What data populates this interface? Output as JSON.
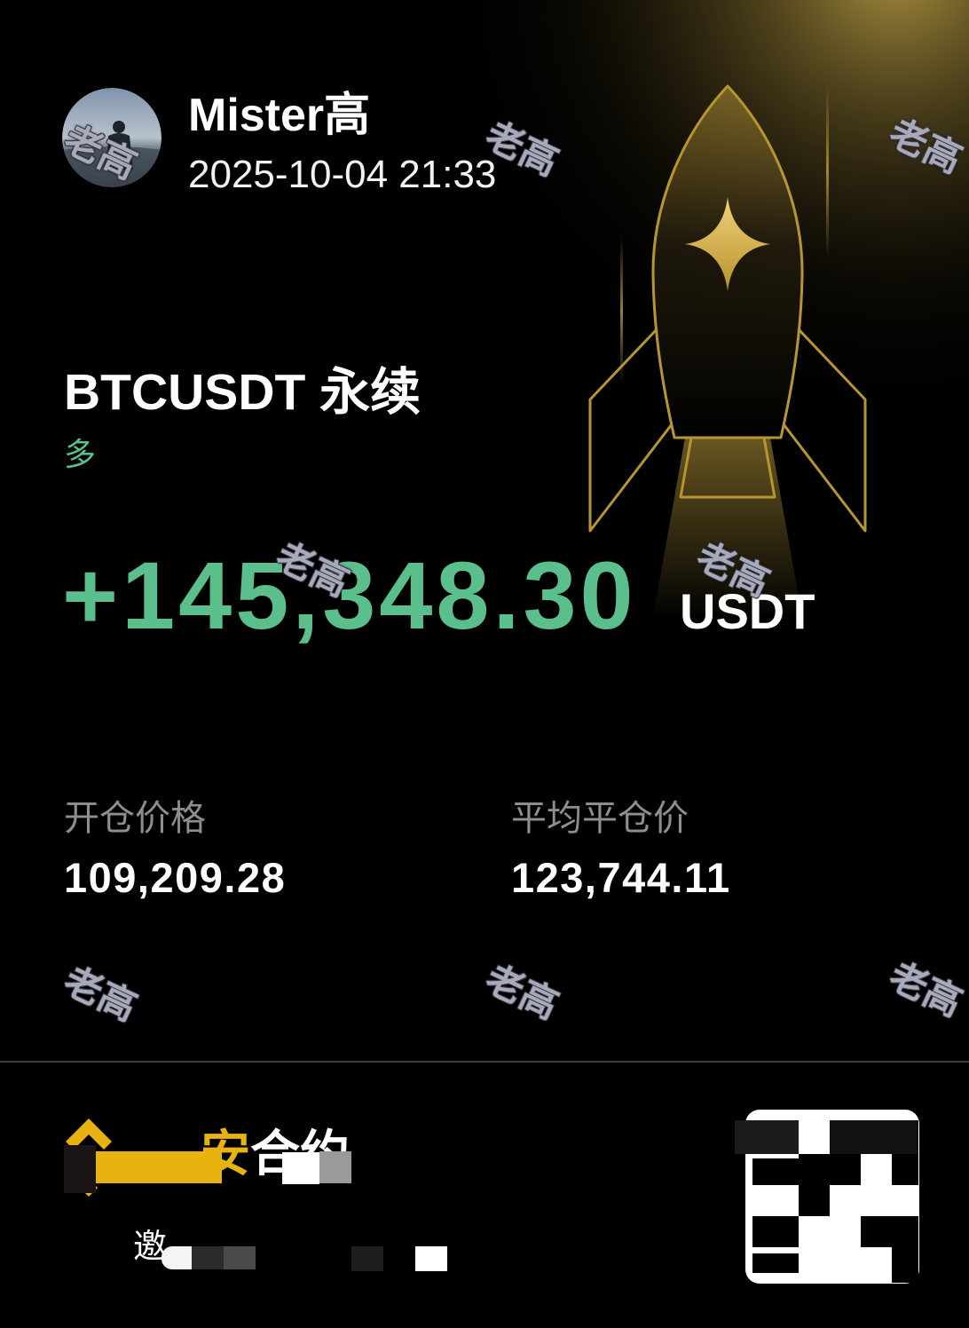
{
  "header": {
    "username": "Mister高",
    "datetime": "2025-10-04 21:33"
  },
  "position": {
    "symbol": "BTCUSDT 永续",
    "side": "多",
    "pnl": "+145,348.30",
    "pnl_unit": "USDT"
  },
  "stats": [
    {
      "label": "开仓价格",
      "value": "109,209.28"
    },
    {
      "label": "平均平仓价",
      "value": "123,744.11"
    }
  ],
  "footer": {
    "brand_fragments": [
      "安",
      "合约"
    ],
    "invite_fragment": "邀"
  },
  "watermark": {
    "text": "老高"
  },
  "icons": {
    "avatar": "avatar-photo",
    "illustration": "rocket-icon",
    "star": "sparkle-icon",
    "logo": "exchange-logo-icon",
    "qr": "qr-code"
  },
  "colors": {
    "background": "#000000",
    "profit_green": "#5bbf8c",
    "label_gray": "#8e8e8e",
    "gold": "#b8962e",
    "brand_yellow": "#e8b30f"
  }
}
